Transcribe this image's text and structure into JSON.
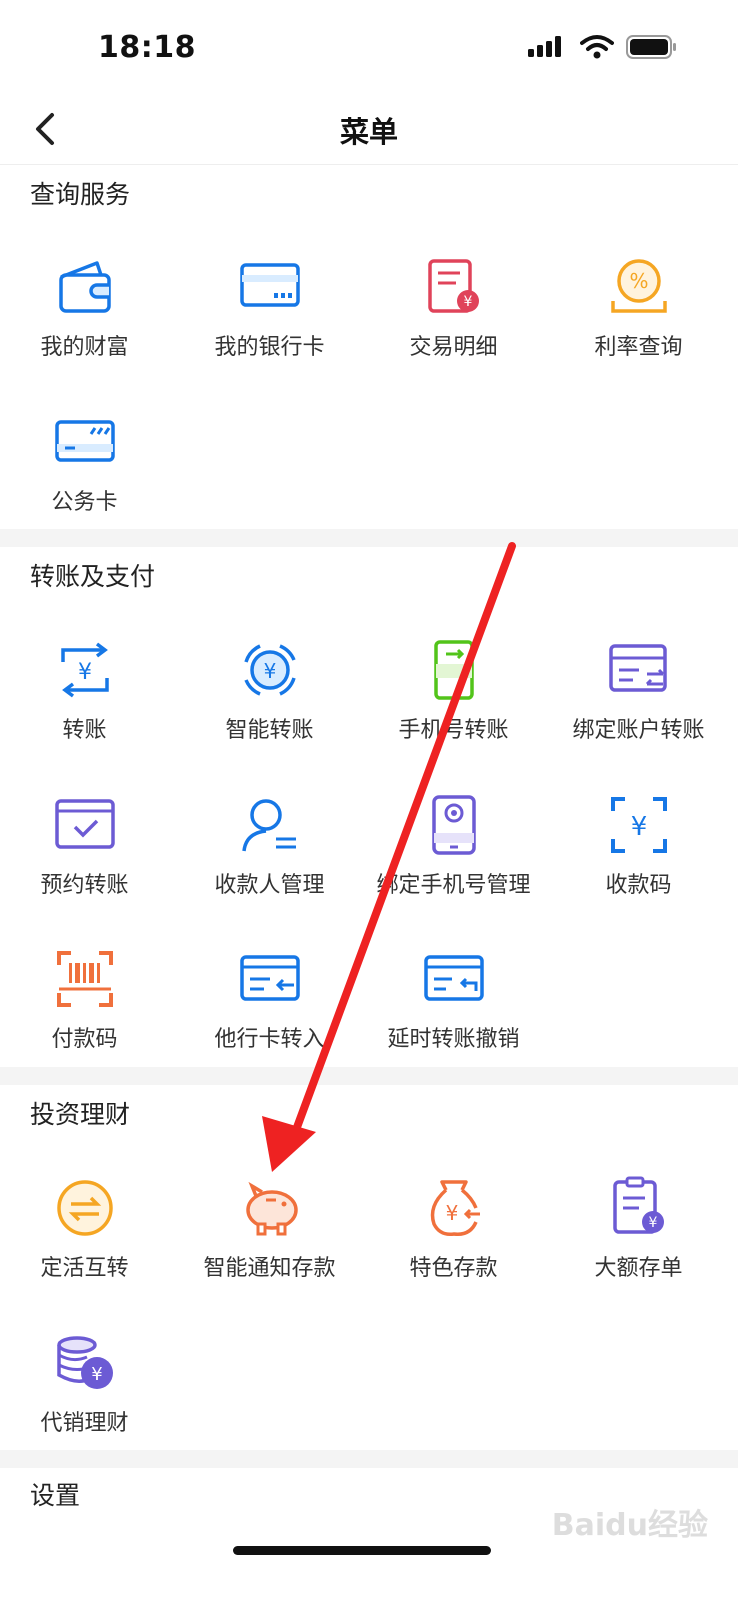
{
  "status_bar": {
    "time": "18:18"
  },
  "header": {
    "title": "菜单"
  },
  "sections": [
    {
      "title": "查询服务",
      "items": [
        {
          "label": "我的财富",
          "icon": "wallet-icon"
        },
        {
          "label": "我的银行卡",
          "icon": "bank-card-icon"
        },
        {
          "label": "交易明细",
          "icon": "transaction-detail-icon"
        },
        {
          "label": "利率查询",
          "icon": "interest-rate-icon"
        },
        {
          "label": "公务卡",
          "icon": "official-card-icon"
        }
      ]
    },
    {
      "title": "转账及支付",
      "items": [
        {
          "label": "转账",
          "icon": "transfer-icon"
        },
        {
          "label": "智能转账",
          "icon": "smart-transfer-icon"
        },
        {
          "label": "手机号转账",
          "icon": "phone-transfer-icon"
        },
        {
          "label": "绑定账户转账",
          "icon": "bound-account-transfer-icon"
        },
        {
          "label": "预约转账",
          "icon": "scheduled-transfer-icon"
        },
        {
          "label": "收款人管理",
          "icon": "payee-management-icon"
        },
        {
          "label": "绑定手机号管理",
          "icon": "phone-binding-icon"
        },
        {
          "label": "收款码",
          "icon": "receive-code-icon"
        },
        {
          "label": "付款码",
          "icon": "pay-code-icon"
        },
        {
          "label": "他行卡转入",
          "icon": "other-bank-transfer-in-icon"
        },
        {
          "label": "延时转账撤销",
          "icon": "delayed-transfer-cancel-icon"
        }
      ]
    },
    {
      "title": "投资理财",
      "items": [
        {
          "label": "定活互转",
          "icon": "fixed-demand-switch-icon"
        },
        {
          "label": "智能通知存款",
          "icon": "piggy-bank-icon"
        },
        {
          "label": "特色存款",
          "icon": "money-bag-icon"
        },
        {
          "label": "大额存单",
          "icon": "large-deposit-icon"
        },
        {
          "label": "代销理财",
          "icon": "coins-icon"
        }
      ]
    },
    {
      "title": "设置",
      "items": []
    }
  ],
  "watermark": "Baidu经验",
  "colors": {
    "blue": "#1677e6",
    "red": "#e0435a",
    "orange": "#f5a623",
    "green": "#52c41a",
    "purple": "#6c5bd4",
    "coral": "#f0703c",
    "annotation": "#ee2222"
  }
}
